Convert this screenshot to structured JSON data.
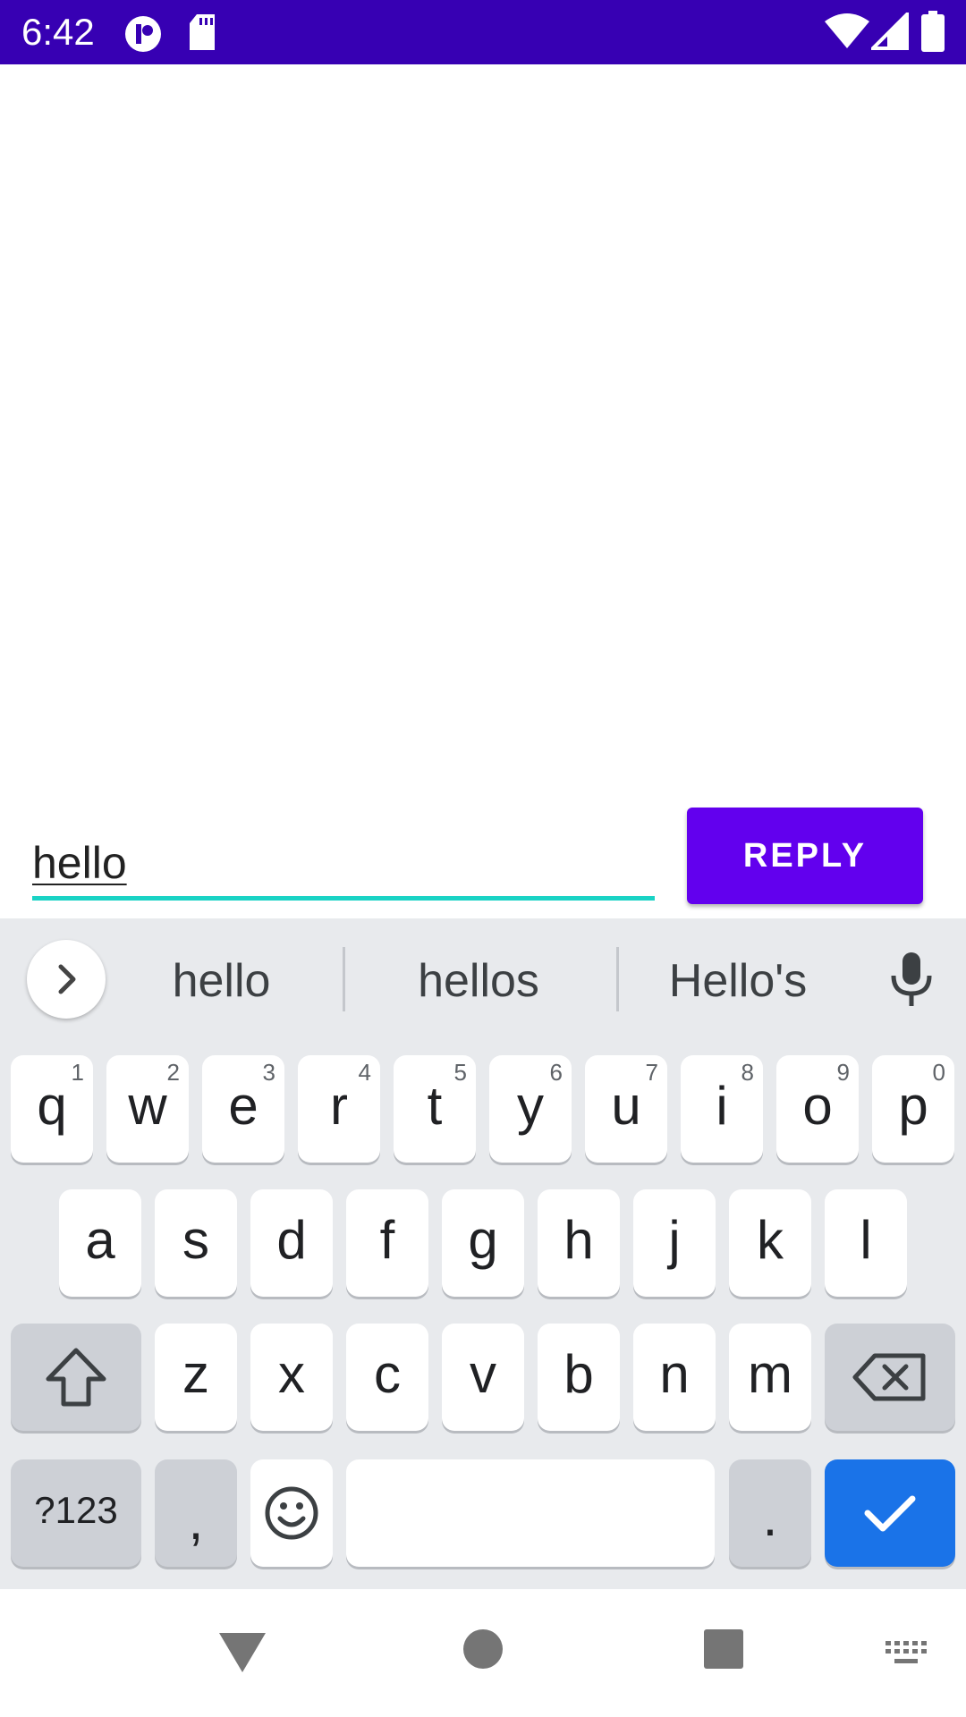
{
  "status_bar": {
    "time": "6:42",
    "left_icons": [
      "app-notification-icon",
      "sd-card-icon"
    ],
    "right_icons": [
      "wifi-icon",
      "cell-signal-icon",
      "battery-icon"
    ],
    "background": "#3700b3"
  },
  "reply": {
    "input_value": "hello",
    "button_label": "REPLY",
    "accent": "#6200ee",
    "underline_color": "#19d3c5"
  },
  "keyboard": {
    "suggestions": [
      "hello",
      "hellos",
      "Hello's"
    ],
    "row1": [
      {
        "label": "q",
        "hint": "1"
      },
      {
        "label": "w",
        "hint": "2"
      },
      {
        "label": "e",
        "hint": "3"
      },
      {
        "label": "r",
        "hint": "4"
      },
      {
        "label": "t",
        "hint": "5"
      },
      {
        "label": "y",
        "hint": "6"
      },
      {
        "label": "u",
        "hint": "7"
      },
      {
        "label": "i",
        "hint": "8"
      },
      {
        "label": "o",
        "hint": "9"
      },
      {
        "label": "p",
        "hint": "0"
      }
    ],
    "row2": [
      "a",
      "s",
      "d",
      "f",
      "g",
      "h",
      "j",
      "k",
      "l"
    ],
    "row3": [
      "z",
      "x",
      "c",
      "v",
      "b",
      "n",
      "m"
    ],
    "symbols_label": "?123",
    "comma_label": ",",
    "period_label": ".",
    "enter_color": "#1a73e8"
  },
  "nav_bar": {
    "icons": [
      "back-icon",
      "home-icon",
      "recents-icon",
      "keyboard-switch-icon"
    ]
  }
}
